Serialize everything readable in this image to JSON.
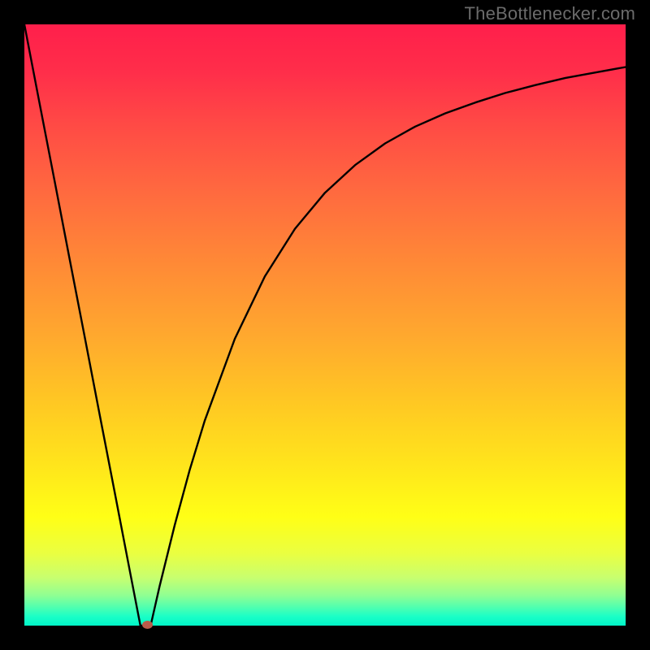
{
  "watermark": "TheBottlenecker.com",
  "chart_data": {
    "type": "line",
    "title": "",
    "xlabel": "",
    "ylabel": "",
    "x": [
      0.0,
      0.025,
      0.05,
      0.075,
      0.1,
      0.125,
      0.15,
      0.175,
      0.193,
      0.2,
      0.21,
      0.225,
      0.25,
      0.275,
      0.3,
      0.35,
      0.4,
      0.45,
      0.5,
      0.55,
      0.6,
      0.65,
      0.7,
      0.75,
      0.8,
      0.85,
      0.9,
      0.95,
      1.0
    ],
    "y": [
      1.0,
      0.87,
      0.741,
      0.611,
      0.482,
      0.352,
      0.223,
      0.093,
      0.0,
      0.0,
      0.0,
      0.066,
      0.167,
      0.259,
      0.341,
      0.477,
      0.581,
      0.66,
      0.72,
      0.766,
      0.802,
      0.83,
      0.852,
      0.87,
      0.886,
      0.899,
      0.911,
      0.92,
      0.929
    ],
    "xlim": [
      0,
      1
    ],
    "ylim": [
      0,
      1
    ],
    "min_point": {
      "x": 0.205,
      "y": 0.0
    },
    "notes": "Black curve on rainbow vertical gradient. No axis ticks or numeric labels are visible; x and y are normalized estimates read from pixel positions."
  },
  "colors": {
    "background": "#000000",
    "curve": "#000000",
    "watermark": "#6b6b6b",
    "min_point": "#bb5a4a"
  }
}
